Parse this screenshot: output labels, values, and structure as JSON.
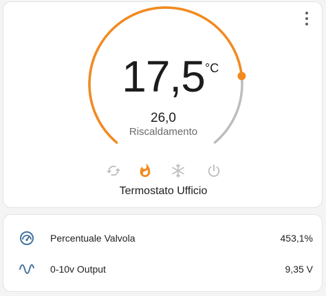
{
  "thermostat": {
    "current_temperature": "17,5",
    "unit": "°C",
    "target_temperature": "26,0",
    "hvac_action": "Riscaldamento",
    "name": "Termostato Ufficio",
    "modes": [
      "auto-icon",
      "fire-icon",
      "snowflake-icon",
      "power-icon"
    ],
    "active_mode": "fire-icon",
    "setpoint_fraction": 0.8,
    "accent_color": "#f38a1e",
    "inactive_color": "#bdbdbd",
    "menu_icon": "more-vert-icon"
  },
  "entities": [
    {
      "icon": "gauge-icon",
      "name": "Percentuale Valvola",
      "value": "453,1%"
    },
    {
      "icon": "sine-wave-icon",
      "name": "0-10v Output",
      "value": "9,35 V"
    }
  ]
}
